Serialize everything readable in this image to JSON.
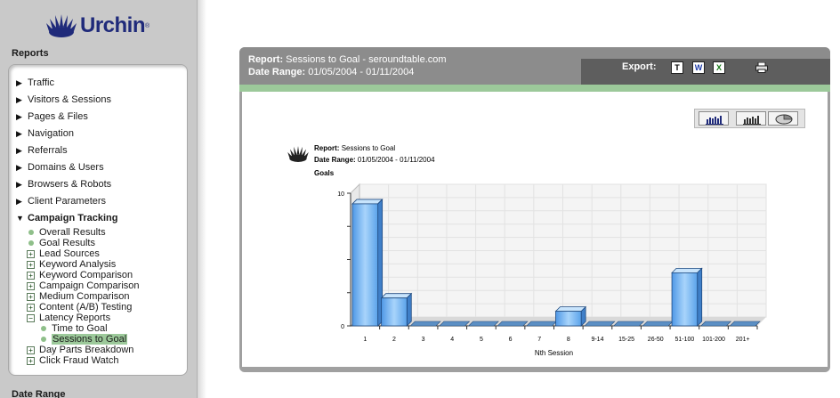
{
  "brand": {
    "name": "Urchin",
    "mark": "®"
  },
  "sidebar": {
    "reports_heading": "Reports",
    "date_range_heading": "Date Range",
    "top_items": [
      {
        "label": "Traffic",
        "expanded": false
      },
      {
        "label": "Visitors & Sessions",
        "expanded": false
      },
      {
        "label": "Pages & Files",
        "expanded": false
      },
      {
        "label": "Navigation",
        "expanded": false
      },
      {
        "label": "Referrals",
        "expanded": false
      },
      {
        "label": "Domains & Users",
        "expanded": false
      },
      {
        "label": "Browsers & Robots",
        "expanded": false
      },
      {
        "label": "Client Parameters",
        "expanded": false
      },
      {
        "label": "Campaign Tracking",
        "expanded": true
      }
    ],
    "campaign_items": [
      {
        "label": "Overall Results",
        "kind": "dot"
      },
      {
        "label": "Goal Results",
        "kind": "dot"
      },
      {
        "label": "Lead Sources",
        "kind": "plus"
      },
      {
        "label": "Keyword Analysis",
        "kind": "plus"
      },
      {
        "label": "Keyword Comparison",
        "kind": "plus"
      },
      {
        "label": "Campaign Comparison",
        "kind": "plus"
      },
      {
        "label": "Medium Comparison",
        "kind": "plus"
      },
      {
        "label": "Content (A/B) Testing",
        "kind": "plus"
      },
      {
        "label": "Latency Reports",
        "kind": "minus"
      },
      {
        "label": "Time to Goal",
        "kind": "subdot"
      },
      {
        "label": "Sessions to Goal",
        "kind": "subdot",
        "selected": true
      },
      {
        "label": "Day Parts Breakdown",
        "kind": "plus"
      },
      {
        "label": "Click Fraud Watch",
        "kind": "plus"
      }
    ]
  },
  "panel": {
    "report_label": "Report:",
    "report_value": "Sessions to Goal - seroundtable.com",
    "range_label": "Date Range:",
    "range_value": "01/05/2004 - 01/11/2004",
    "export_label": "Export:",
    "export_icons": [
      "T",
      "W",
      "X"
    ]
  },
  "chart_info": {
    "report_label": "Report:",
    "report_value": "Sessions to Goal",
    "range_label": "Date Range:",
    "range_value": "01/05/2004 - 01/11/2004"
  },
  "colors": {
    "sidebar_bg": "#c9c9c9",
    "accent_green": "#9cc99a",
    "header_gray": "#8c8c8c",
    "header_dark": "#5e5e5e",
    "bar_blue": "#7fb8f0",
    "brand_blue": "#1f2a7a"
  },
  "chart_data": {
    "type": "bar",
    "ylabel": "Goals",
    "xlabel": "Nth Session",
    "categories": [
      "1",
      "2",
      "3",
      "4",
      "5",
      "6",
      "7",
      "8",
      "9-14",
      "15-25",
      "26-50",
      "51-100",
      "101-200",
      "201+"
    ],
    "values": [
      9.2,
      2.1,
      0,
      0,
      0,
      0,
      0,
      1.1,
      0,
      0,
      0,
      4.0,
      0,
      0
    ],
    "ylim": [
      0,
      10
    ],
    "yticks": [
      0,
      10
    ],
    "grid": true
  }
}
